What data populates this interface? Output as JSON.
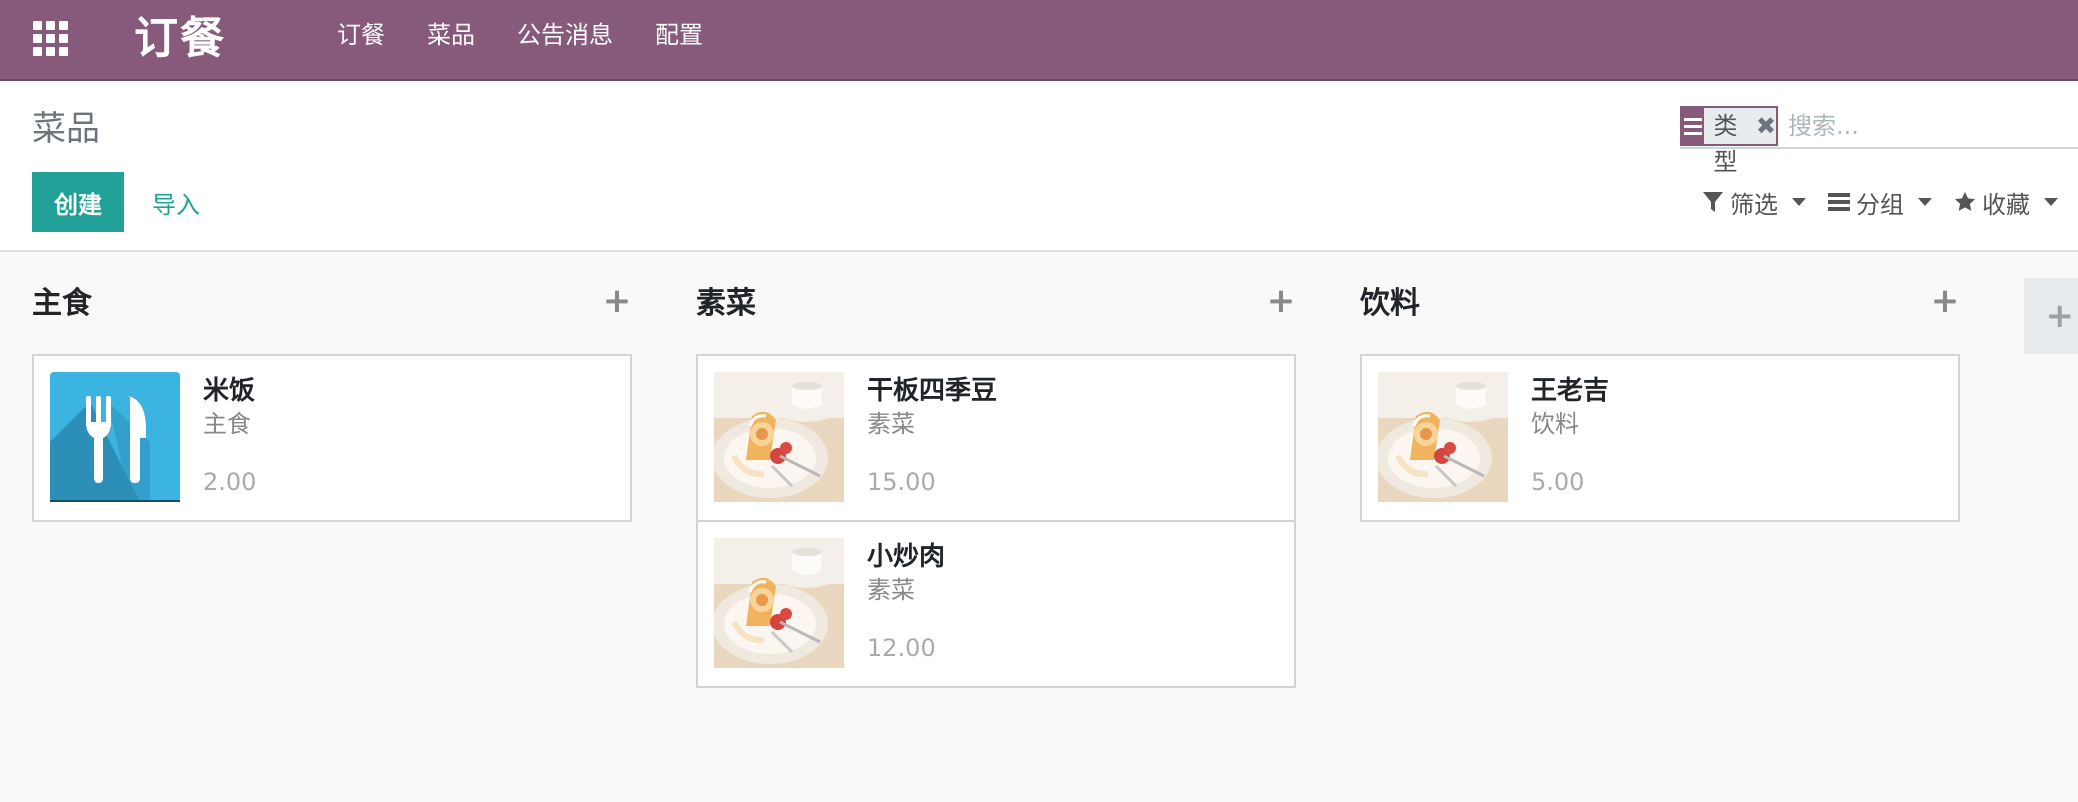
{
  "navbar": {
    "brand": "订餐",
    "menu": [
      {
        "label": "订餐"
      },
      {
        "label": "菜品"
      },
      {
        "label": "公告消息"
      },
      {
        "label": "配置"
      }
    ],
    "apps_icon": "apps-grid-icon",
    "color": "#875a7b"
  },
  "control_panel": {
    "breadcrumb": "菜品",
    "create_label": "创建",
    "import_label": "导入",
    "search": {
      "facet_value": "类型",
      "facet_remove": "✖",
      "placeholder": "搜索..."
    },
    "options": {
      "filter_label": "筛选",
      "group_label": "分组",
      "favorite_label": "收藏"
    }
  },
  "kanban": {
    "columns": [
      {
        "title": "主食",
        "add": "+",
        "cards": [
          {
            "name": "米饭",
            "category": "主食",
            "price": "2.00",
            "image": "cutlery-placeholder"
          }
        ]
      },
      {
        "title": "素菜",
        "add": "+",
        "cards": [
          {
            "name": "干板四季豆",
            "category": "素菜",
            "price": "15.00",
            "image": "cake-photo"
          },
          {
            "name": "小炒肉",
            "category": "素菜",
            "price": "12.00",
            "image": "cake-photo"
          }
        ]
      },
      {
        "title": "饮料",
        "add": "+",
        "cards": [
          {
            "name": "王老吉",
            "category": "饮料",
            "price": "5.00",
            "image": "cake-photo"
          }
        ]
      }
    ],
    "add_column": "+"
  },
  "colors": {
    "primary": "#21a098",
    "navbar": "#875a7b"
  }
}
